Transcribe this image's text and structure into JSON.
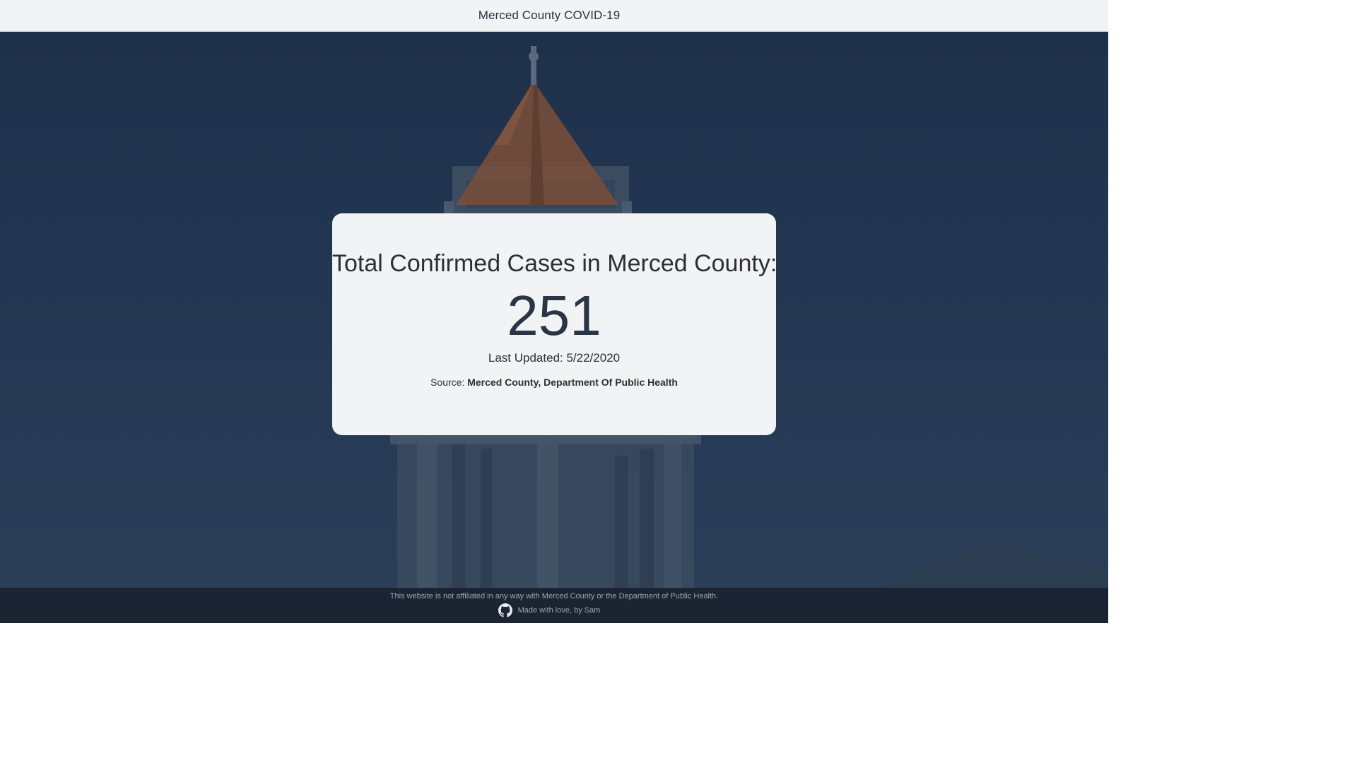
{
  "navbar": {
    "title": "Merced County COVID-19"
  },
  "card": {
    "heading": "Total Confirmed Cases in Merced County:",
    "count": "251",
    "last_updated": "Last Updated: 5/22/2020",
    "source_prefix": "Source:",
    "source_name": "Merced County, Department Of Public Health"
  },
  "footer": {
    "disclaimer": "This website is not affiliated in any way with Merced County or the Department of Public Health.",
    "credit": "Made with love, by Sam",
    "icon": "github-icon"
  },
  "colors": {
    "navbar_bg": "#f2f3f5",
    "hero_overlay": "#243750",
    "card_bg": "#f2f3f5",
    "footer_bg": "#1b2432",
    "count_text": "#2a3545"
  }
}
